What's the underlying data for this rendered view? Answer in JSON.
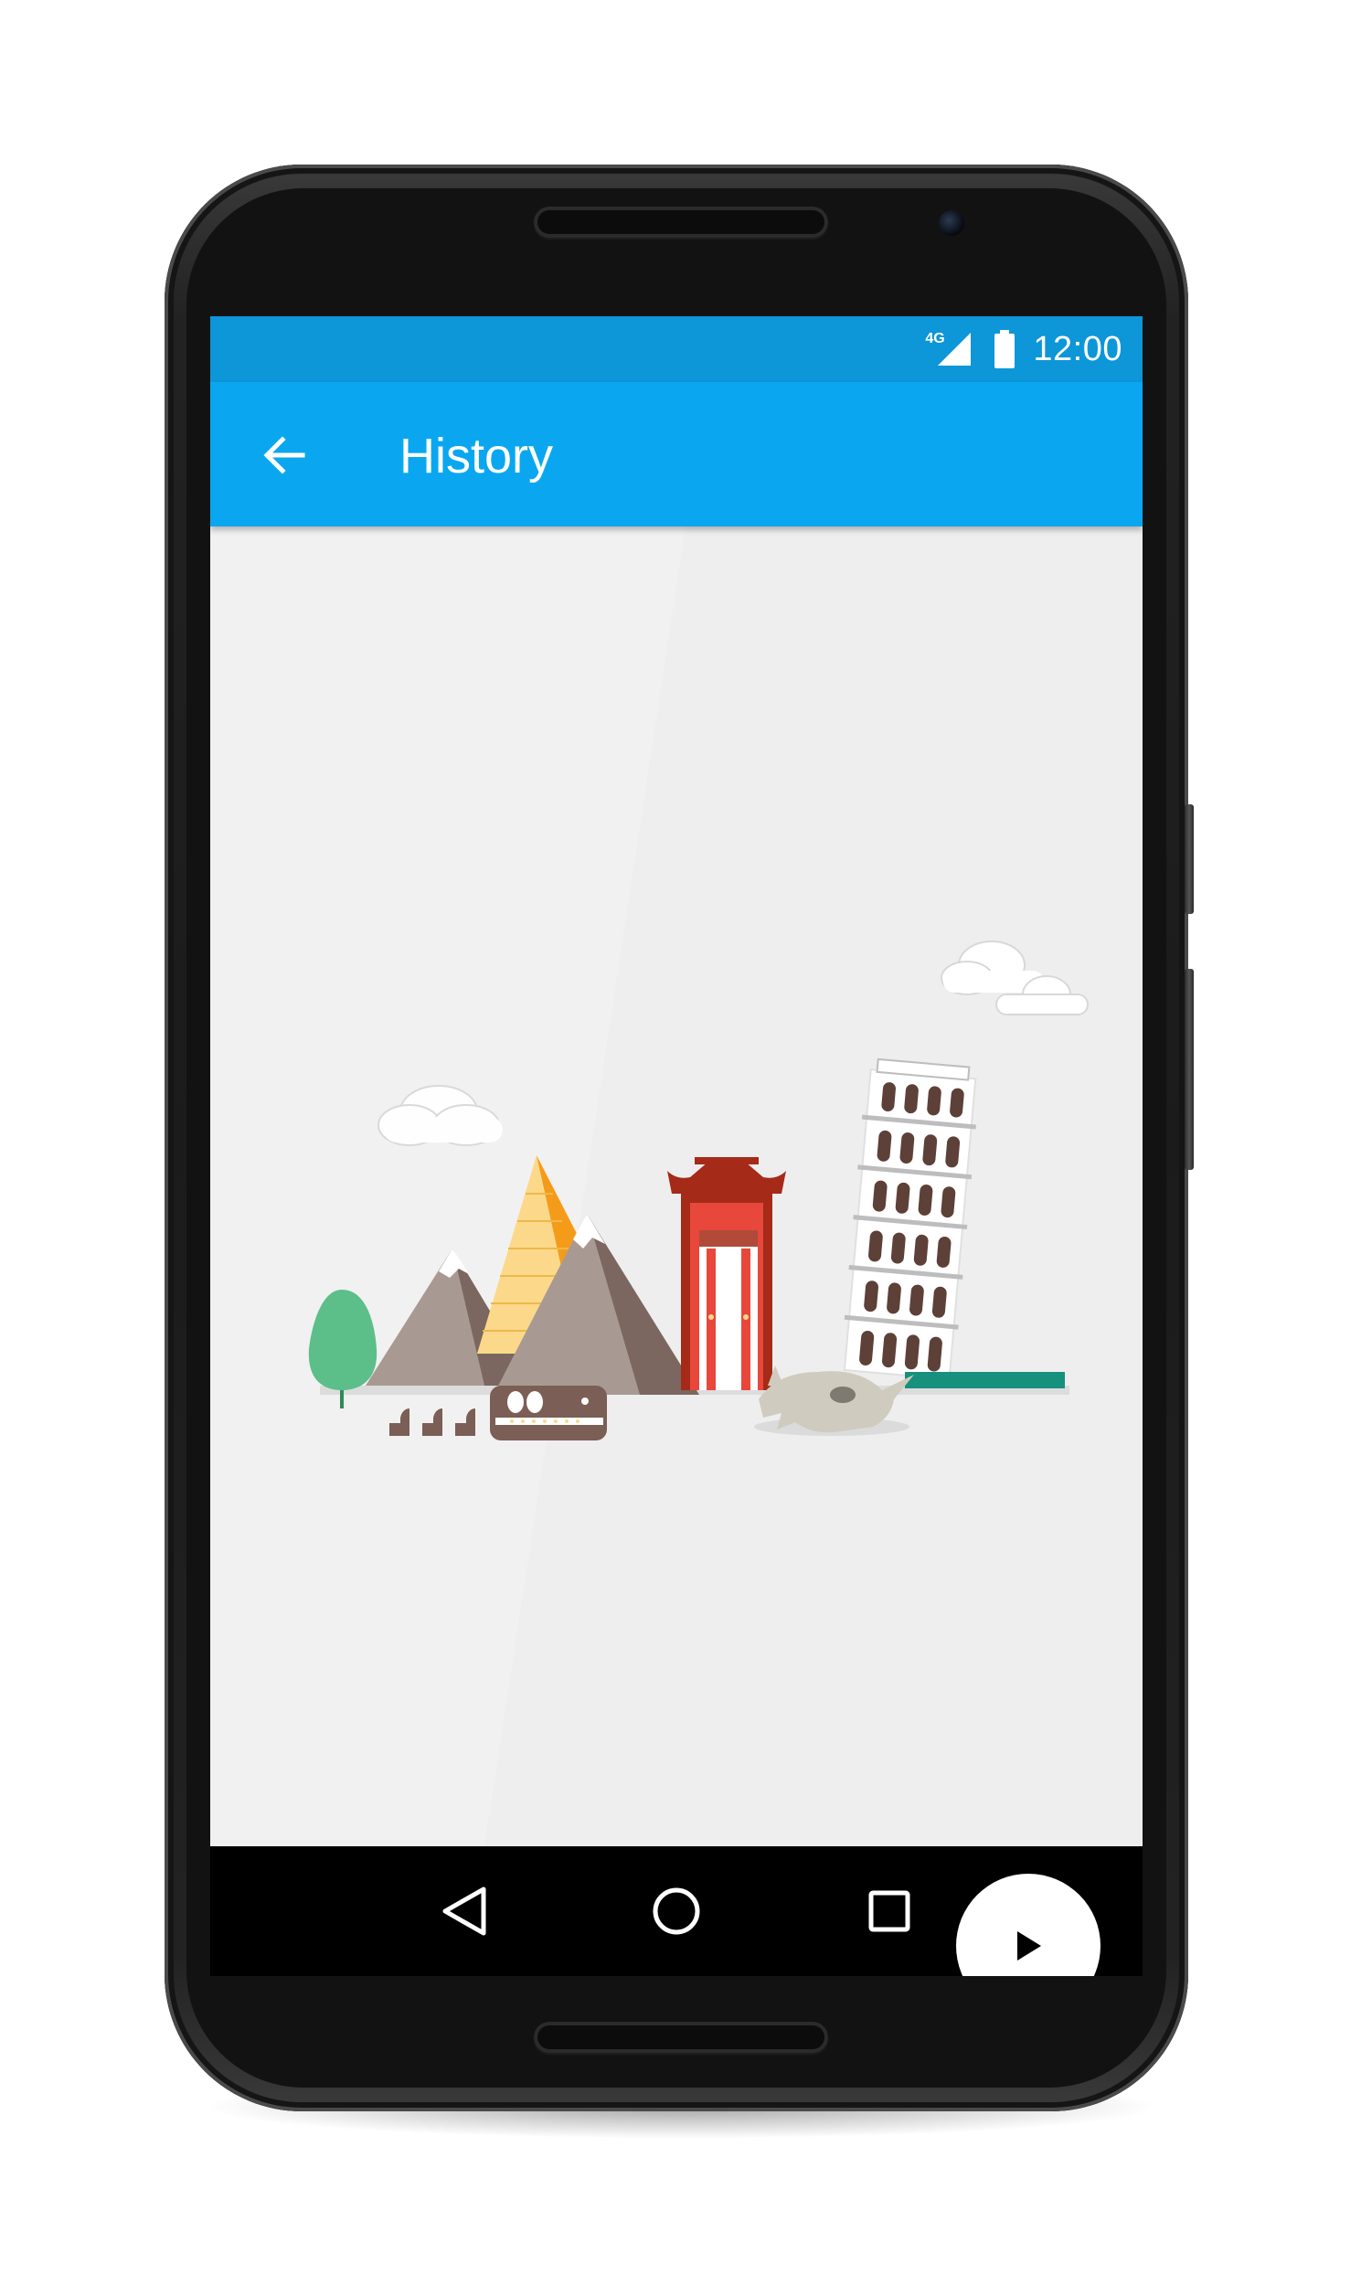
{
  "status_bar": {
    "network": "4G",
    "time": "12:00",
    "signal_icon": "cell-signal-icon",
    "battery_icon": "battery-full-icon"
  },
  "app_bar": {
    "title": "History",
    "back_icon": "arrow-back-icon"
  },
  "fab": {
    "icon": "play-icon"
  },
  "nav_bar": {
    "back_icon": "triangle-back-icon",
    "home_icon": "circle-home-icon",
    "recents_icon": "square-recents-icon"
  },
  "colors": {
    "status_bar": "#0d96d8",
    "app_bar": "#0aa7f0",
    "content_background": "#eeeeee",
    "fab_background": "#ffffff",
    "nav_bar": "#000000"
  }
}
